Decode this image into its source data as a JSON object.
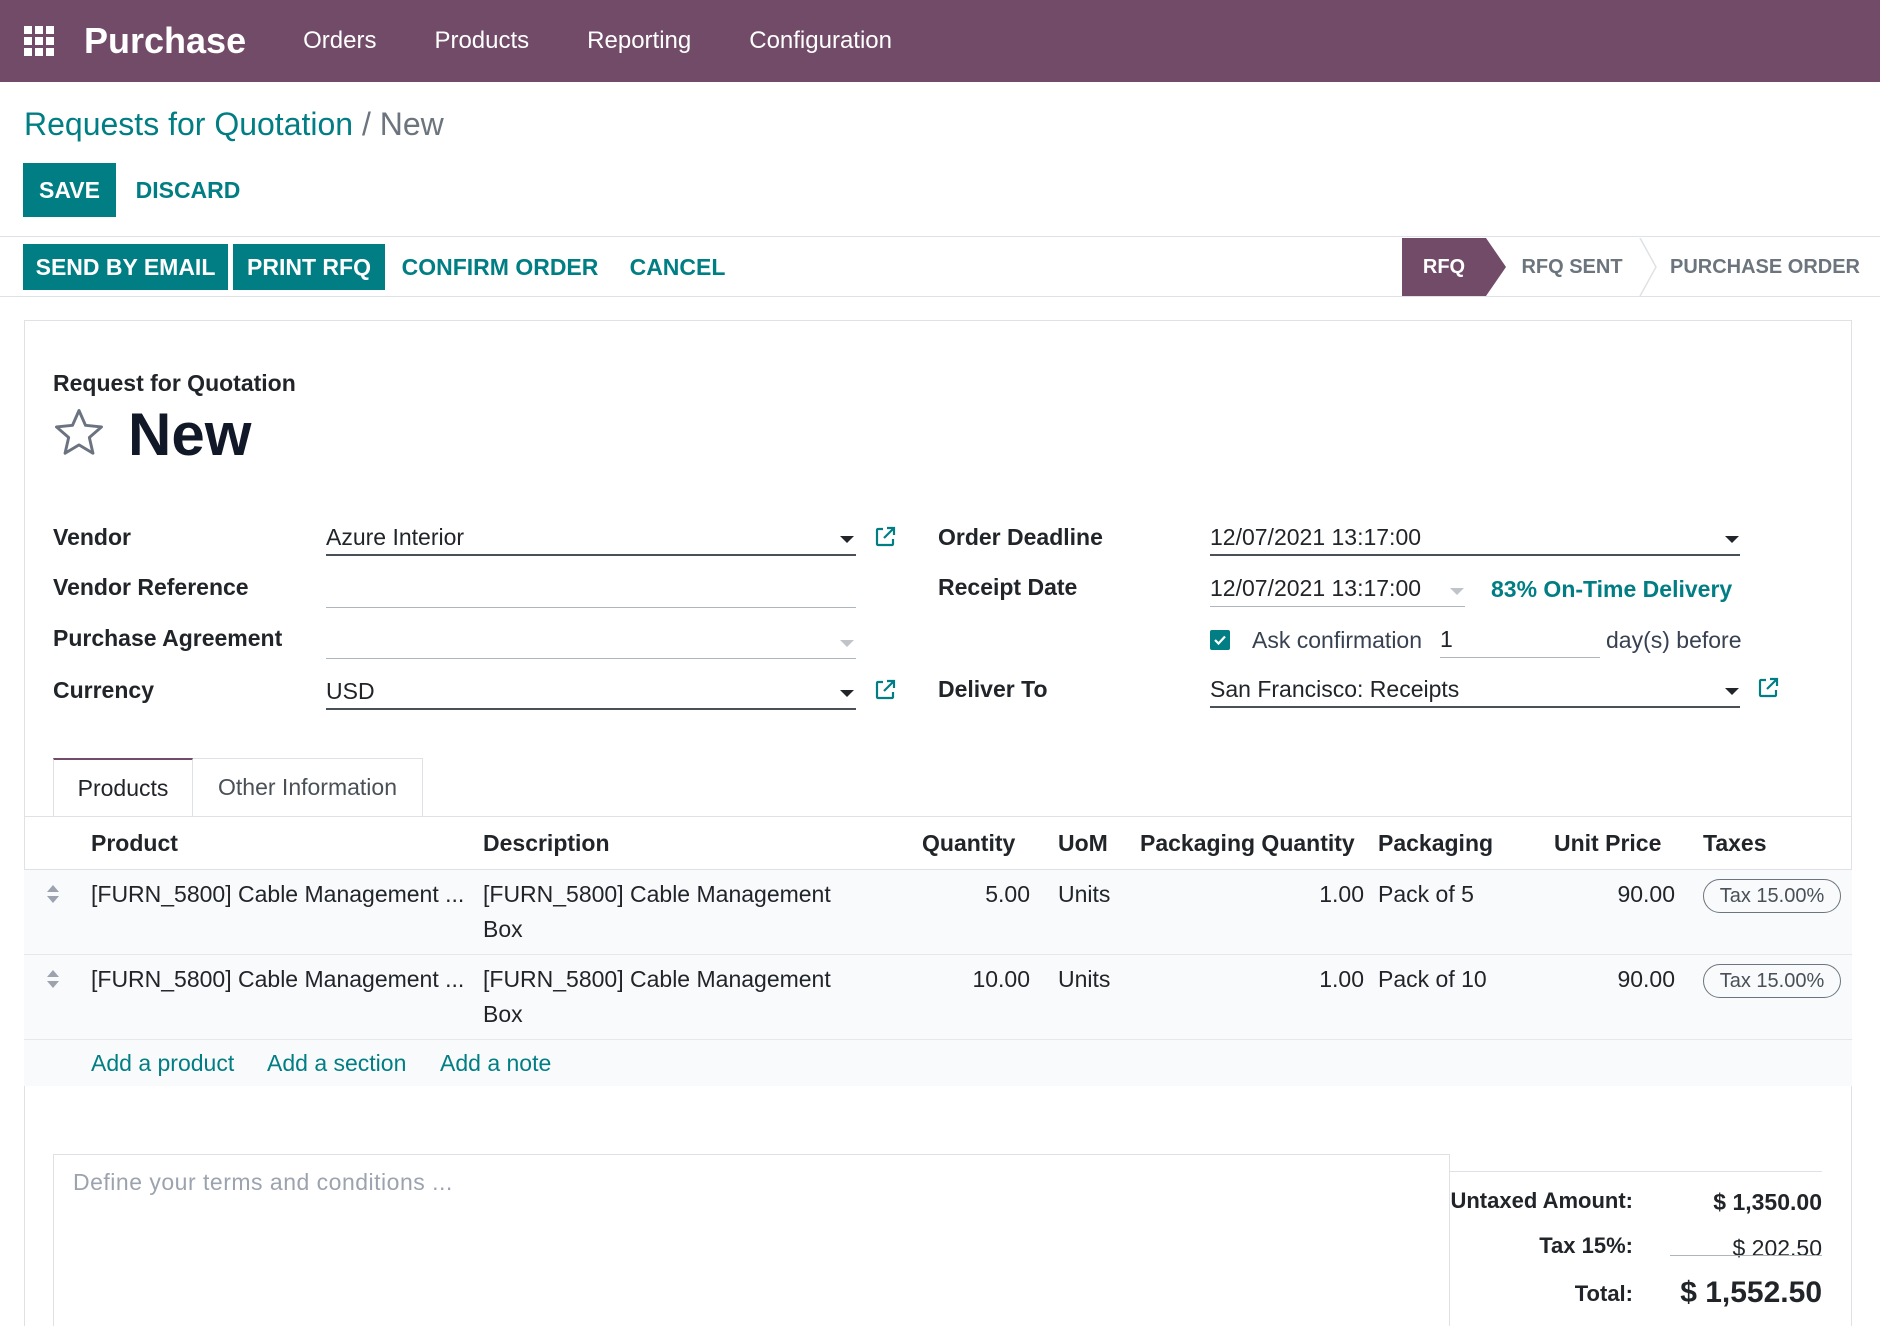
{
  "navbar": {
    "app_name": "Purchase",
    "menu": [
      "Orders",
      "Products",
      "Reporting",
      "Configuration"
    ]
  },
  "breadcrumb": {
    "parent": "Requests for Quotation",
    "separator": "/",
    "current": "New"
  },
  "control": {
    "save": "SAVE",
    "discard": "DISCARD"
  },
  "actions": {
    "send_email": "SEND BY EMAIL",
    "print_rfq": "PRINT RFQ",
    "confirm_order": "CONFIRM ORDER",
    "cancel": "CANCEL"
  },
  "statusbar": {
    "stages": [
      "RFQ",
      "RFQ SENT",
      "PURCHASE ORDER"
    ],
    "active": "RFQ"
  },
  "form": {
    "subtitle": "Request for Quotation",
    "title": "New",
    "left": {
      "vendor_label": "Vendor",
      "vendor_value": "Azure Interior",
      "vendor_ref_label": "Vendor Reference",
      "vendor_ref_value": "",
      "agreement_label": "Purchase Agreement",
      "agreement_value": "",
      "currency_label": "Currency",
      "currency_value": "USD"
    },
    "right": {
      "deadline_label": "Order Deadline",
      "deadline_value": "12/07/2021 13:17:00",
      "receipt_label": "Receipt Date",
      "receipt_value": "12/07/2021 13:17:00",
      "on_time": "83% On-Time Delivery",
      "ask_confirmation_label": "Ask confirmation",
      "ask_confirmation_checked": true,
      "ask_days": "1",
      "days_before": "day(s) before",
      "deliver_label": "Deliver To",
      "deliver_value": "San Francisco: Receipts"
    }
  },
  "tabs": [
    "Products",
    "Other Information"
  ],
  "table": {
    "headers": [
      "Product",
      "Description",
      "Quantity",
      "UoM",
      "Packaging Quantity",
      "Packaging",
      "Unit Price",
      "Taxes"
    ],
    "rows": [
      {
        "product": "[FURN_5800] Cable Management ...",
        "description_1": "[FURN_5800] Cable Management",
        "description_2": "Box",
        "quantity": "5.00",
        "uom": "Units",
        "packaging_qty": "1.00",
        "packaging": "Pack of 5",
        "unit_price": "90.00",
        "tax": "Tax 15.00%"
      },
      {
        "product": "[FURN_5800] Cable Management ...",
        "description_1": "[FURN_5800] Cable Management",
        "description_2": "Box",
        "quantity": "10.00",
        "uom": "Units",
        "packaging_qty": "1.00",
        "packaging": "Pack of 10",
        "unit_price": "90.00",
        "tax": "Tax 15.00%"
      }
    ],
    "add_product": "Add a product",
    "add_section": "Add a section",
    "add_note": "Add a note"
  },
  "notes_placeholder": "Define your terms and conditions ...",
  "totals": {
    "untaxed_label": "Untaxed Amount:",
    "untaxed_value": "$ 1,350.00",
    "tax_label": "Tax 15%:",
    "tax_value": "$ 202.50",
    "total_label": "Total:",
    "total_value": "$ 1,552.50"
  },
  "colors": {
    "brand": "#714b67",
    "primary": "#017e84"
  }
}
